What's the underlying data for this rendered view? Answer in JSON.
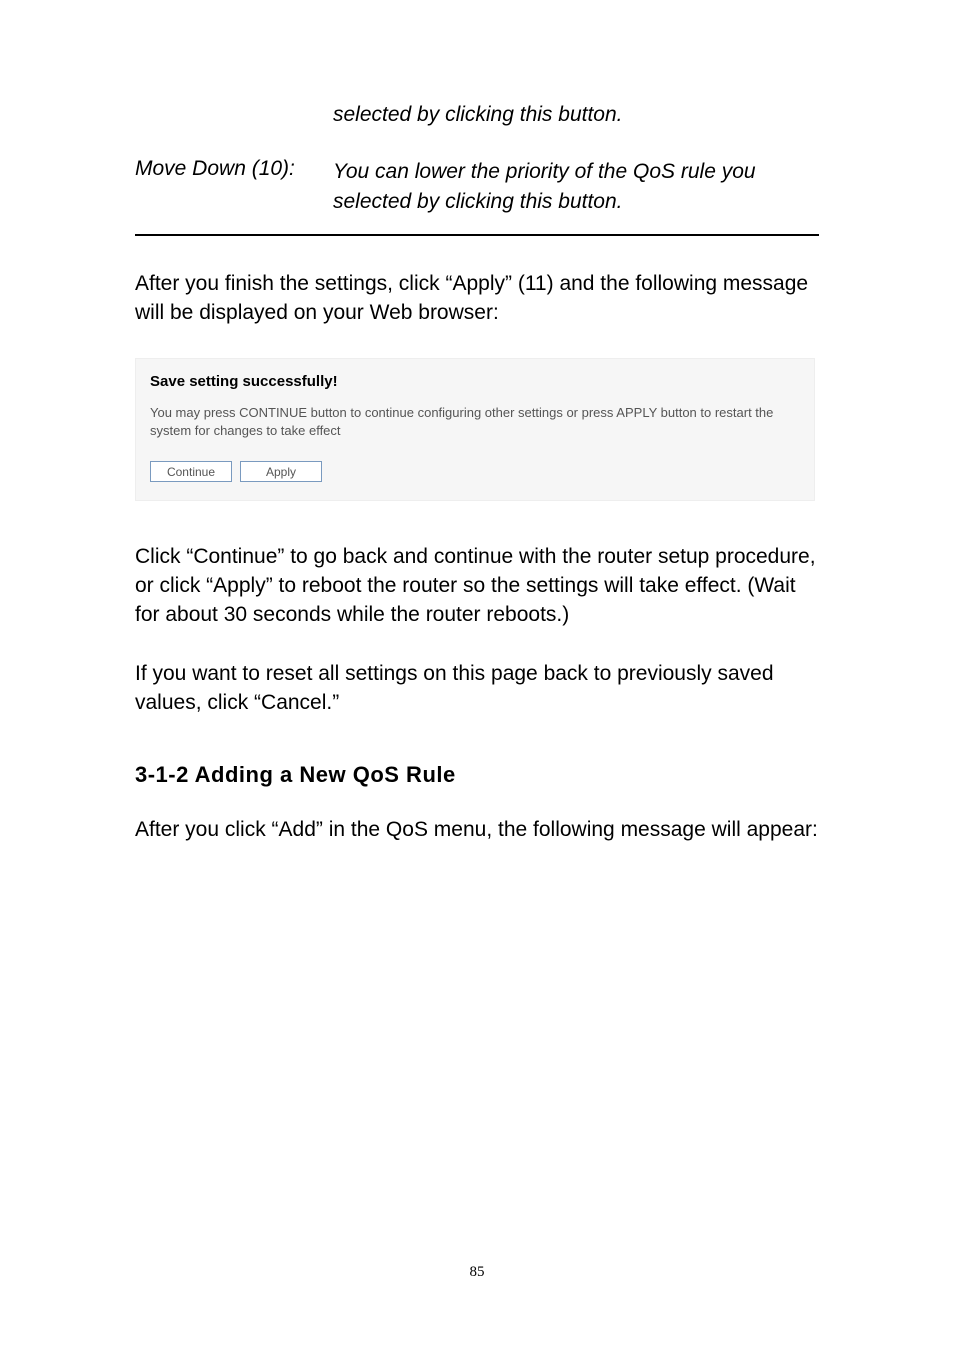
{
  "firstIndented": "selected by clicking this button.",
  "moveDown": {
    "label": "Move Down (10):",
    "desc": "You can lower the priority of the QoS rule you selected by clicking this button."
  },
  "afterFinish": "After you finish the settings, click “Apply” (11) and the following message will be displayed on your Web browser:",
  "dialog": {
    "title": "Save setting successfully!",
    "desc": "You may press CONTINUE button to continue configuring other settings or press APPLY button to restart the system for changes to take effect",
    "continue": "Continue",
    "apply": "Apply"
  },
  "clickContinue": "Click “Continue” to go back and continue with the router setup procedure, or click “Apply” to reboot the router so the settings will take effect. (Wait for about 30 seconds while the router reboots.)",
  "resetText": "If you want to reset all settings on this page back to previously saved values, click “Cancel.”",
  "sectionHeading": "3-1-2 Adding a New QoS Rule",
  "afterAdd": "After you click “Add” in the QoS menu, the following message will appear:",
  "pageNumber": "85"
}
